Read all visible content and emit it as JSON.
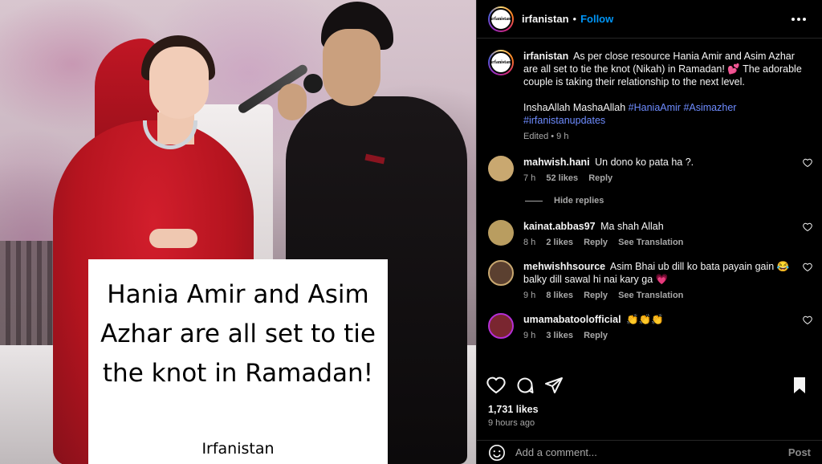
{
  "post": {
    "overlay_headline": "Hania Amir and Asim Azhar are all set to tie the knot in Ramadan!",
    "overlay_brand": "Irfanistan"
  },
  "header": {
    "username": "irfanistan",
    "separator": "•",
    "follow_label": "Follow",
    "avatar_text": "irfanistan"
  },
  "caption": {
    "username": "irfanistan",
    "text": "As per close resource Hania Amir and Asim Azhar are all set to tie the knot (Nikah) in Ramadan! 💕 The adorable couple is taking their relationship to the next level.",
    "line2": "InshaAllah MashaAllah",
    "hashtags": [
      "#HaniaAmir",
      "#Asimazher",
      "#irfanistanupdates"
    ],
    "meta": "Edited • 9 h"
  },
  "comments": [
    {
      "username": "mahwish.hani",
      "text": "Un dono ko pata ha ?.",
      "time": "7 h",
      "likes": "52 likes",
      "reply": "Reply",
      "translation": "",
      "avatar_color": "#c9a870"
    },
    {
      "username": "kainat.abbas97",
      "text": "Ma shah Allah",
      "time": "8 h",
      "likes": "2 likes",
      "reply": "Reply",
      "translation": "See Translation",
      "avatar_color": "#b99d60"
    },
    {
      "username": "mehwishhsource",
      "text": "Asim Bhai ub dill ko bata payain gain 😂 balky dill sawal hi nai kary ga 💗",
      "time": "9 h",
      "likes": "8 likes",
      "reply": "Reply",
      "translation": "See Translation",
      "avatar_color": "#5b4030"
    },
    {
      "username": "umamabatoolofficial",
      "text": "👏👏👏",
      "time": "9 h",
      "likes": "3 likes",
      "reply": "Reply",
      "translation": "",
      "avatar_color": "#7a2630"
    }
  ],
  "hide_replies_label": "Hide replies",
  "likes_count": "1,731 likes",
  "posted_time": "9 hours ago",
  "comment_box": {
    "placeholder": "Add a comment...",
    "post_label": "Post"
  },
  "colors": {
    "link": "#0095f6",
    "hashtag": "#6e8cff",
    "muted": "#a8a8a8",
    "background": "#000000"
  },
  "icons": [
    "more-icon",
    "heart-icon",
    "comment-icon",
    "share-icon",
    "bookmark-icon",
    "emoji-icon"
  ]
}
